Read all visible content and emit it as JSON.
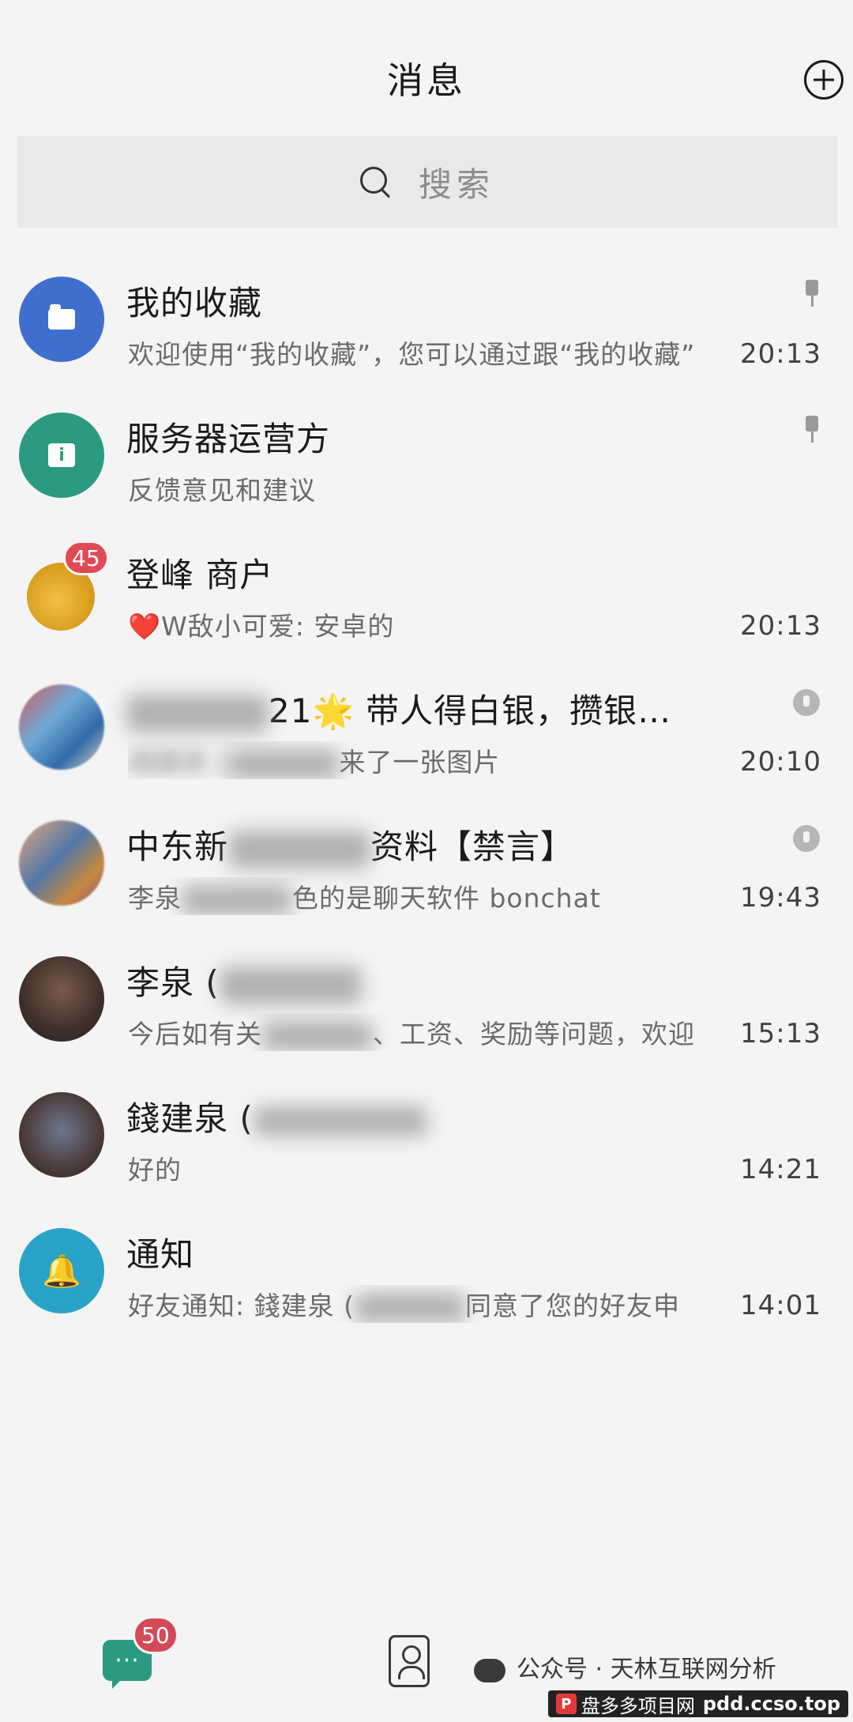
{
  "header": {
    "title": "消息",
    "search_placeholder": "搜索"
  },
  "conversations": [
    {
      "name": "我的收藏",
      "preview": "欢迎使用“我的收藏”，您可以通过跟“我的收藏”",
      "time": "20:13",
      "pinned": true,
      "avatar_icon": "folder-icon",
      "avatar_color": "#3e6fcf"
    },
    {
      "name": "服务器运营方",
      "preview": "反馈意见和建议",
      "time": "",
      "pinned": true,
      "avatar_icon": "info-icon",
      "avatar_color": "#2b9a82"
    },
    {
      "name": "登峰 商户",
      "preview_emoji": "❤️",
      "preview": "W敌小可爱: 安卓的",
      "time": "20:13",
      "badge": "45",
      "avatar_icon": "money-bag-icon"
    },
    {
      "name_prefix": "21",
      "name_star": "🌟",
      "name": "带人得白银，攒银…",
      "preview_prefix": "錢建泉 (",
      "preview": "来了一张图片",
      "time": "20:10",
      "muted": true
    },
    {
      "name": "中东新",
      "name_suffix": "资料【禁言】",
      "preview_prefix": "李泉",
      "preview": "色的是聊天软件 bonchat",
      "time": "19:43",
      "muted": true
    },
    {
      "name": "李泉 (",
      "preview_prefix": "今后如有关",
      "preview": "、工资、奖励等问题，欢迎",
      "time": "15:13"
    },
    {
      "name": "錢建泉 (",
      "preview": "好的",
      "time": "14:21"
    },
    {
      "name": "通知",
      "preview_prefix": "好友通知: 錢建泉 (",
      "preview": "同意了您的好友申",
      "time": "14:01",
      "avatar_icon": "bell-icon",
      "avatar_color": "#2aa3c9"
    }
  ],
  "bottom_nav": {
    "chat_icon_text": "···",
    "chat_badge": "50",
    "watermark_text": "公众号 · 天林互联网分析",
    "site_logo": "P",
    "site_name": "盘多多项目网",
    "site_url": "pdd.ccso.top"
  },
  "colors": {
    "accent": "#2b9a82",
    "badge_red": "#e04a55",
    "background": "#f4f4f4"
  }
}
